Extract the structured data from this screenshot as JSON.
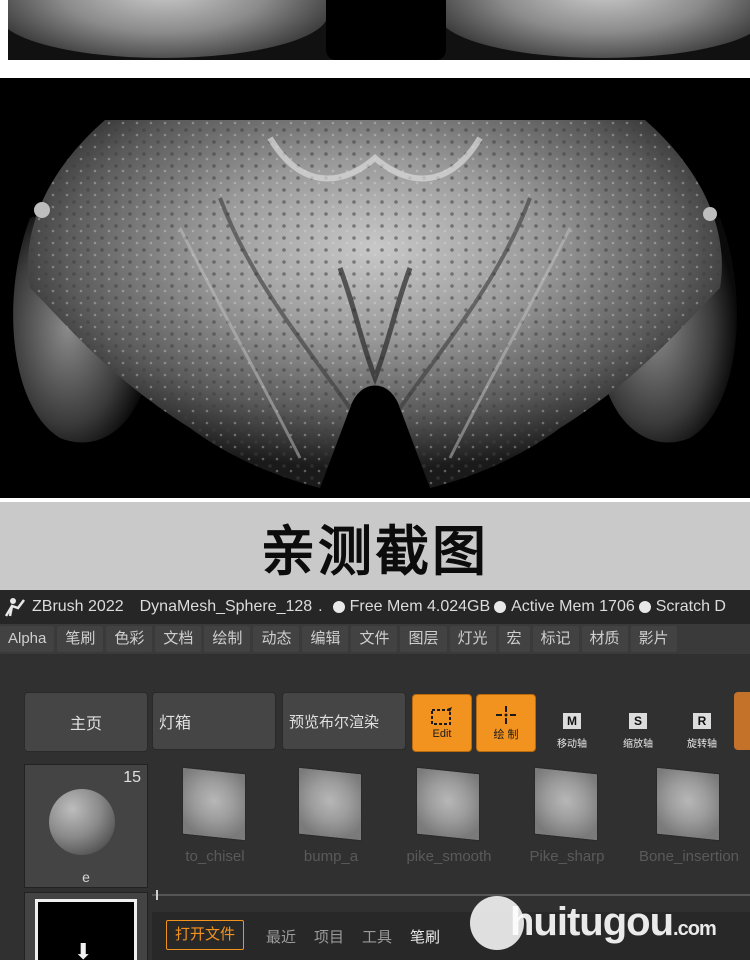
{
  "caption": "亲测截图",
  "titlebar": {
    "app": "ZBrush 2022",
    "project": "DynaMesh_Sphere_128",
    "free_mem": "Free Mem 4.024GB",
    "active_mem": "Active Mem 1706",
    "scratch": "Scratch D"
  },
  "menu": [
    "Alpha",
    "笔刷",
    "色彩",
    "文档",
    "绘制",
    "动态",
    "编辑",
    "文件",
    "图层",
    "灯光",
    "宏",
    "标记",
    "材质",
    "影片"
  ],
  "toolbar": {
    "home": "主页",
    "lightbox": "灯箱",
    "bpr": "预览布尔渲染",
    "edit": "Edit",
    "draw": "绘 制",
    "move": "移动轴",
    "scale": "缩放轴",
    "rotate": "旋转轴",
    "move_key": "M",
    "scale_key": "S",
    "rotate_key": "R"
  },
  "brush": {
    "count": "15",
    "label": "e"
  },
  "alphas": [
    "to_chisel",
    "bump_a",
    "pike_smooth",
    "Pike_sharp",
    "Bone_insertion"
  ],
  "bottom_tabs": {
    "open_file": "打开文件",
    "recent": "最近",
    "project": "项目",
    "tool": "工具",
    "brush": "笔刷"
  },
  "watermark": {
    "name": "huitugou",
    "suffix": ".com"
  },
  "colors": {
    "accent": "#f3931f",
    "panel": "#303030",
    "caption_band": "#c9c9c9"
  }
}
